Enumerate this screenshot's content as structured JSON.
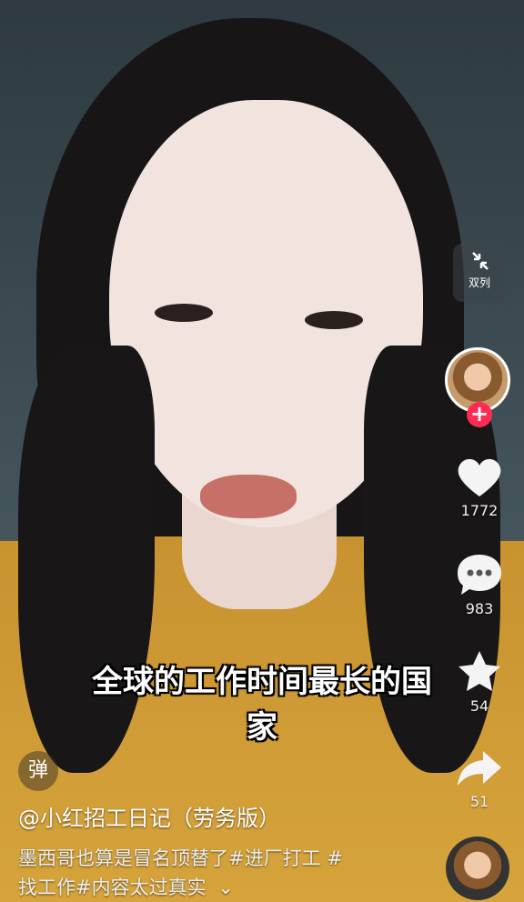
{
  "video": {
    "subtitle_line1": "全球的工作时间最长的国",
    "subtitle_line2": "家"
  },
  "side": {
    "dual_label": "双列",
    "dual_icon": "shrink-arrows-icon",
    "like_count": "1772",
    "comment_count": "983",
    "favorite_count": "54",
    "share_count": "51",
    "follow_symbol": "+",
    "like_color": "#ffffff"
  },
  "bottom": {
    "danmu_label": "弹",
    "author": "@小红招工日记（劳务版）",
    "desc_line1": "墨西哥也算是冒名顶替了#进厂打工 #",
    "desc_line2": "找工作#内容太过真实",
    "expand_symbol": "⌄"
  }
}
